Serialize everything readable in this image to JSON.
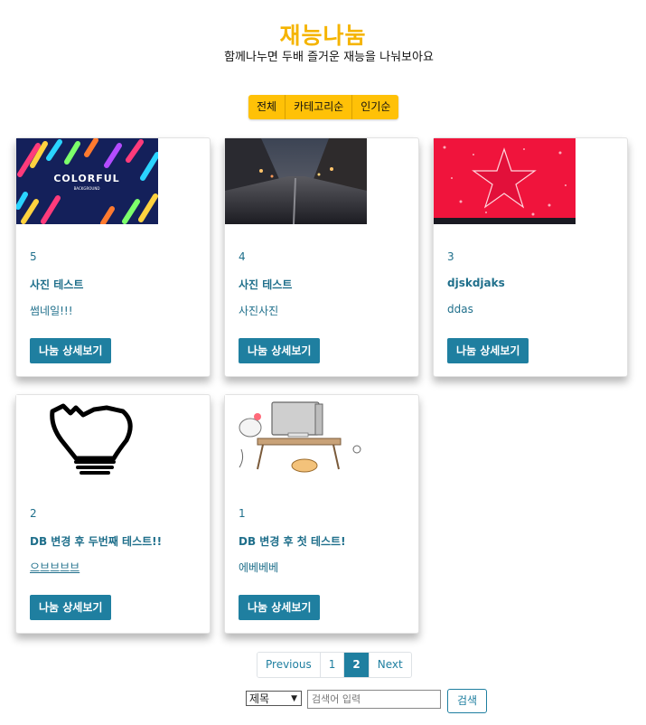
{
  "header": {
    "title": "재능나눔",
    "subtitle": "함께나누면 두배 즐거운 재능을 나눠보아요"
  },
  "filters": [
    {
      "label": "전체"
    },
    {
      "label": "카테고리순"
    },
    {
      "label": "인기순"
    }
  ],
  "posts": [
    {
      "number": "5",
      "title": "사진 테스트",
      "description": "썸네일!!!",
      "detail_label": "나눔 상세보기",
      "thumbnail": "colorful-background-image",
      "thumbnail_text": "COLORFUL",
      "thumbnail_subtext": "BACKGROUND"
    },
    {
      "number": "4",
      "title": "사진 테스트",
      "description": "사진사진",
      "detail_label": "나눔 상세보기",
      "thumbnail": "cobblestone-street-image"
    },
    {
      "number": "3",
      "title": "djskdjaks",
      "description": "ddas",
      "detail_label": "나눔 상세보기",
      "thumbnail": "red-star-image"
    },
    {
      "number": "2",
      "title": "DB 변경 후 두번째 테스트!!",
      "description": "으브브브브",
      "detail_label": "나눔 상세보기",
      "thumbnail": "broken-lightbulb-image"
    },
    {
      "number": "1",
      "title": "DB 변경 후 첫 테스트!",
      "description": "에베베베",
      "detail_label": "나눔 상세보기",
      "thumbnail": "computer-desk-drawing-image"
    }
  ],
  "pagination": {
    "previous": "Previous",
    "pages": [
      "1",
      "2"
    ],
    "current": "2",
    "next": "Next"
  },
  "search": {
    "field_selected": "제목",
    "placeholder": "검색어 입력",
    "button_label": "검색"
  },
  "colors": {
    "accent": "#f5b400",
    "filter_bg": "#ffc107",
    "primary": "#1f7fa0"
  }
}
